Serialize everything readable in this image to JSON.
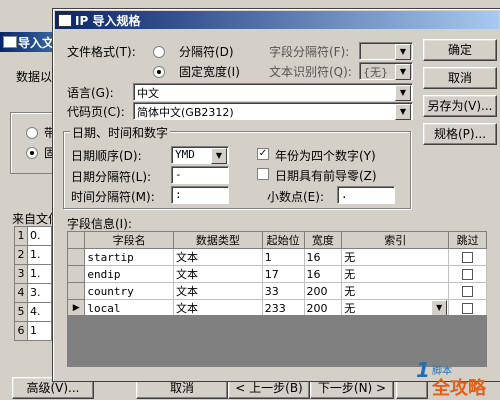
{
  "background": {
    "title": "导入文",
    "label_data": "数据以",
    "radio1": "带",
    "radio2": "固",
    "source_label": "来自文件",
    "rows": [
      {
        "n": "1",
        "v": "0."
      },
      {
        "n": "2",
        "v": "1."
      },
      {
        "n": "3",
        "v": "1."
      },
      {
        "n": "4",
        "v": "3."
      },
      {
        "n": "5",
        "v": "4."
      },
      {
        "n": "6",
        "v": "1"
      }
    ],
    "buttons": {
      "advanced": "高级(V)...",
      "cancel": "取消",
      "prev": "< 上一步(B)",
      "next": "下一步(N) >"
    }
  },
  "dialog": {
    "title": "IP 导入规格",
    "file_format_label": "文件格式(T):",
    "delimited": "分隔符(D)",
    "fixed_width": "固定宽度(I)",
    "field_delim_label": "字段分隔符(F):",
    "field_delim_value": "",
    "text_qualifier_label": "文本识别符(Q):",
    "text_qualifier_value": "{无}",
    "language_label": "语言(G):",
    "language_value": "中文",
    "codepage_label": "代码页(C):",
    "codepage_value": "简体中文(GB2312)",
    "date_group": "日期、时间和数字",
    "date_order_label": "日期顺序(D):",
    "date_order_value": "YMD",
    "four_digit_year": "年份为四个数字(Y)",
    "date_delim_label": "日期分隔符(L):",
    "date_delim_value": "-",
    "leading_zero": "日期具有前导零(Z)",
    "time_delim_label": "时间分隔符(M):",
    "time_delim_value": ":",
    "decimal_label": "小数点(E):",
    "decimal_value": ".",
    "field_info_label": "字段信息(I):",
    "buttons": {
      "ok": "确定",
      "cancel": "取消",
      "save_as": "另存为(V)...",
      "spec": "规格(P)..."
    },
    "columns": [
      "字段名",
      "数据类型",
      "起始位",
      "宽度",
      "索引",
      "跳过"
    ],
    "fields": [
      {
        "name": "startip",
        "type": "文本",
        "start": "1",
        "width": "16",
        "index": "无"
      },
      {
        "name": "endip",
        "type": "文本",
        "start": "17",
        "width": "16",
        "index": "无"
      },
      {
        "name": "country",
        "type": "文本",
        "start": "33",
        "width": "200",
        "index": "无"
      },
      {
        "name": "local",
        "type": "文本",
        "start": "233",
        "width": "200",
        "index": "无"
      }
    ],
    "new_row_marker": "*",
    "current_row_marker": "▶"
  },
  "watermark": {
    "line1": "全攻略",
    "line2": "脚本"
  }
}
